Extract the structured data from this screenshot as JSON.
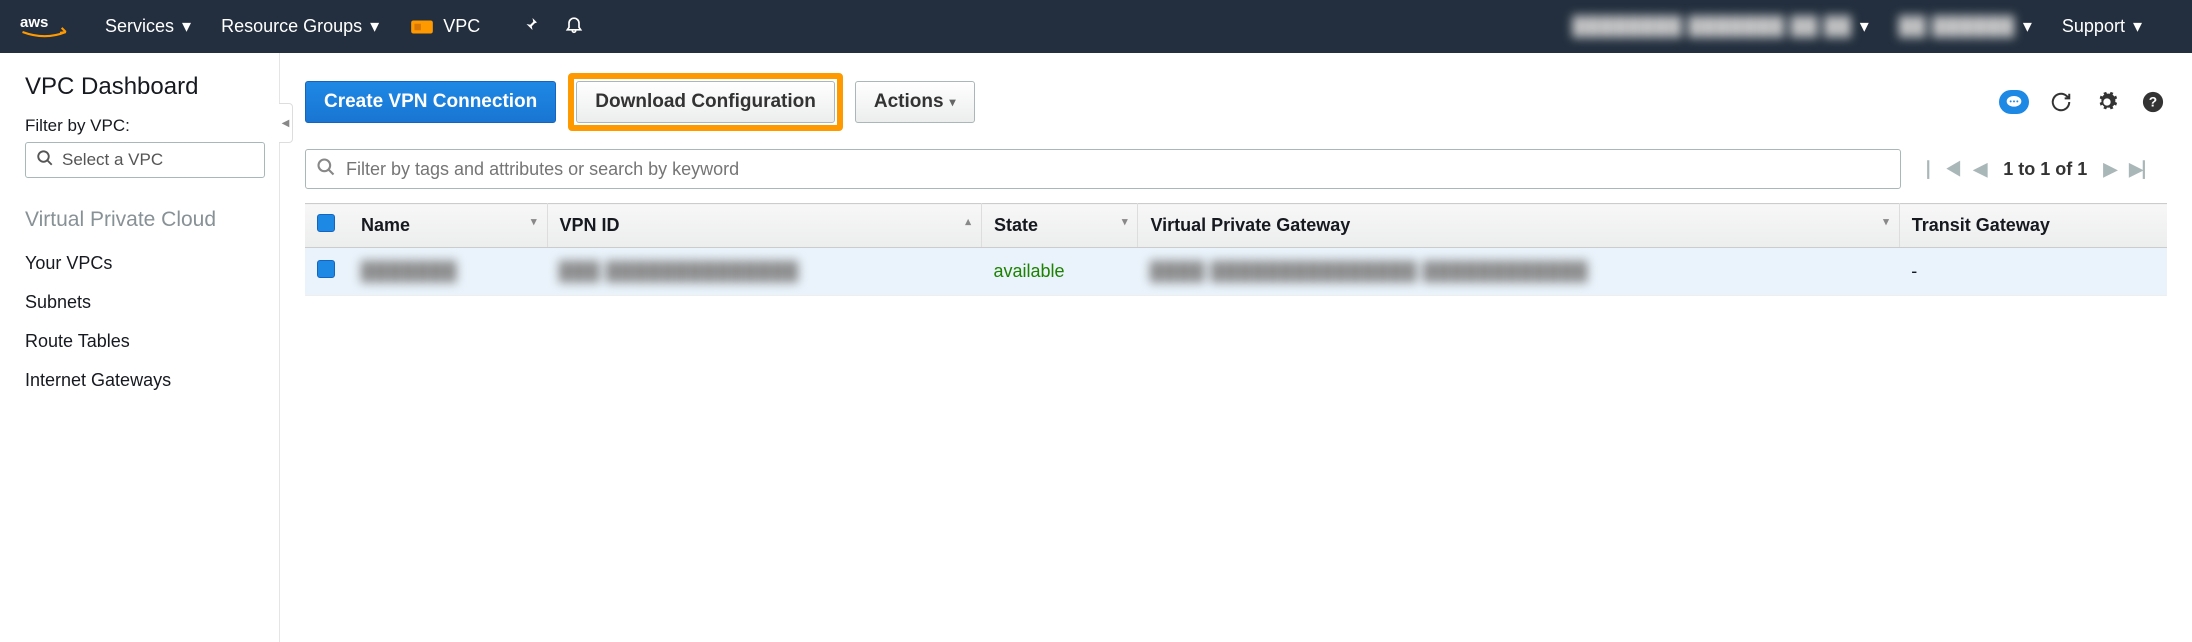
{
  "header": {
    "services": "Services",
    "resource_groups": "Resource Groups",
    "vpc": "VPC",
    "account_blur": "████████ ███████ ██ ██",
    "region_blur": "██ ██████",
    "support": "Support"
  },
  "sidebar": {
    "title": "VPC Dashboard",
    "filter_label": "Filter by VPC:",
    "select_placeholder": "Select a VPC",
    "section": "Virtual Private Cloud",
    "links": [
      "Your VPCs",
      "Subnets",
      "Route Tables",
      "Internet Gateways"
    ]
  },
  "toolbar": {
    "create": "Create VPN Connection",
    "download": "Download Configuration",
    "actions": "Actions"
  },
  "search": {
    "placeholder": "Filter by tags and attributes or search by keyword"
  },
  "pager": {
    "text": "1 to 1 of 1"
  },
  "table": {
    "cols": [
      "Name",
      "VPN ID",
      "State",
      "Virtual Private Gateway",
      "Transit Gateway"
    ],
    "rows": [
      {
        "name_blur": "███████",
        "vpn_id_blur": "███ ██████████████",
        "state": "available",
        "vgw_blur": "████ ███████████████ ████████████",
        "tgw": "-"
      }
    ]
  }
}
